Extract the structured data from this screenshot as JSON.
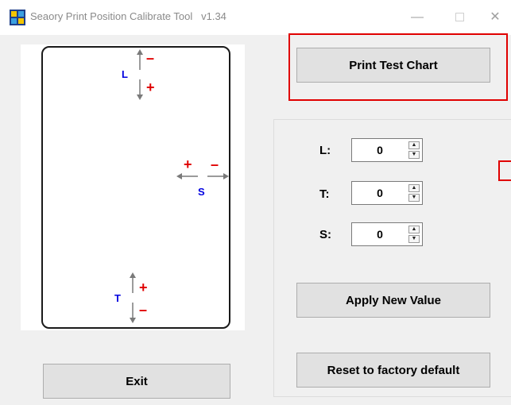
{
  "window": {
    "title": "Seaory Print Position Calibrate Tool",
    "version": "v1.34",
    "minimize_glyph": "—",
    "close_glyph": "✕"
  },
  "card": {
    "label_l": "L",
    "label_s": "S",
    "label_t": "T",
    "plus": "+",
    "minus": "–"
  },
  "buttons": {
    "print_test_chart": "Print Test Chart",
    "apply_new_value": "Apply New Value",
    "reset_factory": "Reset to factory default",
    "exit": "Exit"
  },
  "fields": [
    {
      "label": "L:",
      "value": "0"
    },
    {
      "label": "T:",
      "value": "0"
    },
    {
      "label": "S:",
      "value": "0"
    }
  ],
  "spinner": {
    "up": "▲",
    "down": "▼"
  },
  "colors": {
    "highlight": "#e00000",
    "axis_label": "#0000e0",
    "adjust_sign": "#e00000"
  }
}
